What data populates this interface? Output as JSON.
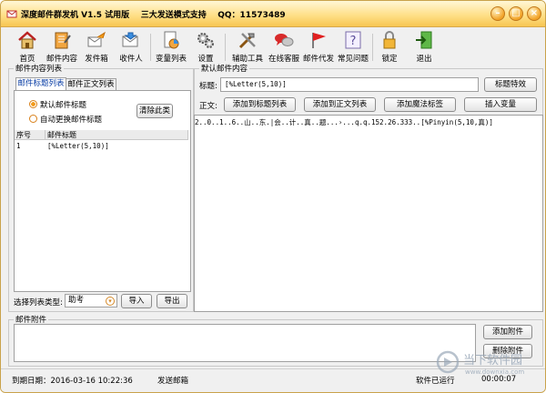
{
  "window": {
    "title": "深度邮件群发机 V1.5 试用版    三大发送模式支持    QQ：11573489",
    "controls": [
      "minimize",
      "maximize",
      "close"
    ]
  },
  "toolbar": {
    "items": [
      {
        "label": "首页",
        "icon": "home-icon"
      },
      {
        "label": "邮件内容",
        "icon": "notebook-icon"
      },
      {
        "label": "发件箱",
        "icon": "outbox-icon"
      },
      {
        "label": "收件人",
        "icon": "recipients-icon"
      },
      {
        "label": "变量列表",
        "icon": "document-chart-icon"
      },
      {
        "label": "设置",
        "icon": "gears-icon"
      },
      {
        "label": "辅助工具",
        "icon": "tools-icon"
      },
      {
        "label": "在线客服",
        "icon": "chat-bubbles-icon"
      },
      {
        "label": "邮件代发",
        "icon": "red-flag-icon"
      },
      {
        "label": "常见问题",
        "icon": "question-icon"
      },
      {
        "label": "锁定",
        "icon": "padlock-icon"
      },
      {
        "label": "退出",
        "icon": "exit-icon"
      }
    ]
  },
  "left_panel": {
    "group_label": "邮件内容列表",
    "tabs": [
      "邮件标题列表",
      "邮件正文列表"
    ],
    "active_tab": 0,
    "radio_default": "默认邮件标题",
    "radio_auto": "自动更换邮件标题",
    "radio_selected": "默认邮件标题",
    "clear_button": "清除此类",
    "table": {
      "columns": [
        "序号",
        "邮件标题"
      ],
      "rows": [
        [
          "1",
          "[%Letter(5,10)]"
        ]
      ]
    },
    "list_type_label": "选择列表类型:",
    "list_type_value": "助考",
    "import_button": "导入",
    "export_button": "导出"
  },
  "right_panel": {
    "group_label": "默认邮件内容",
    "subject_label": "标题:",
    "subject_value": "[%Letter(5,10)]",
    "subject_effect_button": "标题特效",
    "body_label": "正文:",
    "add_to_subject_list": "添加到标题列表",
    "add_to_body_list": "添加到正文列表",
    "add_magic_tag": "添加魔法标签",
    "insert_variable": "插入变量",
    "body_text": "2..0..1..6..山..东.|会..计..真..题...›...q.q.152.26.333..[%Pinyin(5,10,真)]"
  },
  "attachments": {
    "group_label": "邮件附件",
    "add_button": "添加附件",
    "delete_button": "删除附件"
  },
  "status": {
    "expiry": "到期日期：2016-03-16 10:22:36",
    "sending": "发送邮箱",
    "runtime_label": "软件已运行",
    "runtime_value": "00:00:07"
  },
  "watermark": {
    "name": "当下软件园",
    "site": "www.downxia.com"
  },
  "colors": {
    "title_bar": "#f7c652",
    "accent_orange": "#f29a1a",
    "active_tab_text": "#0b3fa6"
  }
}
